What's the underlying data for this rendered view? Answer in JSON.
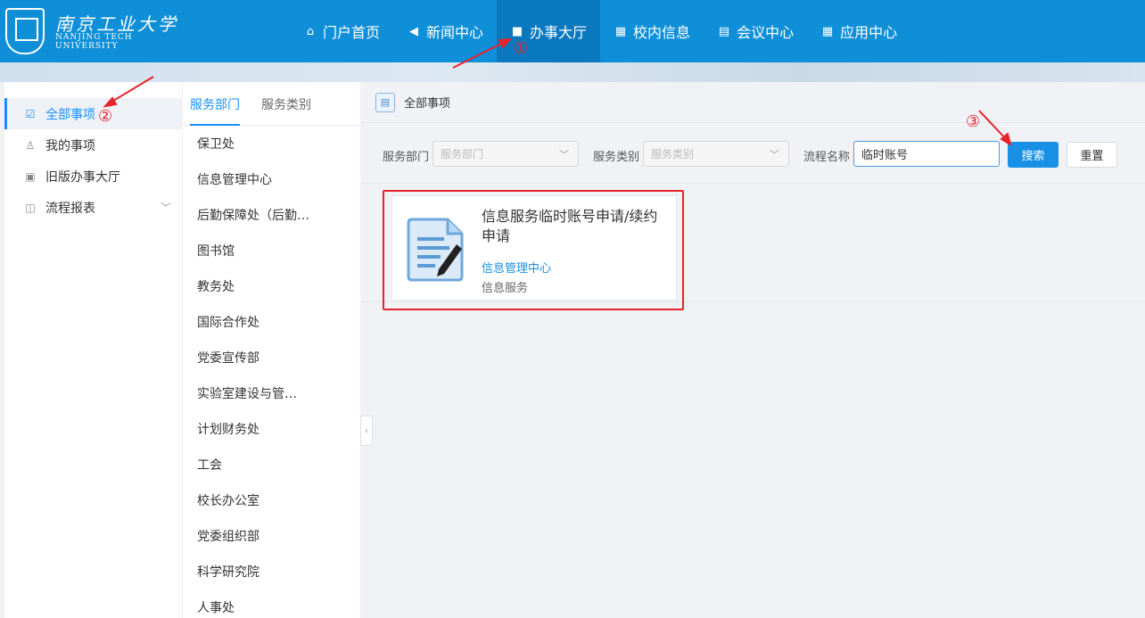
{
  "header": {
    "logo_cn": "南京工业大学",
    "logo_en_line1": "NANJING TECH",
    "logo_en_line2": "UNIVERSITY",
    "nav": [
      {
        "label": "门户首页",
        "icon": "home-icon",
        "glyph": "⌂"
      },
      {
        "label": "新闻中心",
        "icon": "speaker-icon",
        "glyph": "◀"
      },
      {
        "label": "办事大厅",
        "icon": "bag-icon",
        "glyph": "■"
      },
      {
        "label": "校内信息",
        "icon": "building-icon",
        "glyph": "▦"
      },
      {
        "label": "会议中心",
        "icon": "table-icon",
        "glyph": "▤"
      },
      {
        "label": "应用中心",
        "icon": "grid-icon",
        "glyph": "▦"
      }
    ]
  },
  "sidebar": {
    "items": [
      {
        "label": "全部事项",
        "icon": "checkbox-icon",
        "glyph": "☑"
      },
      {
        "label": "我的事项",
        "icon": "user-icon",
        "glyph": "♙"
      },
      {
        "label": "旧版办事大厅",
        "icon": "apps-icon",
        "glyph": "▣"
      },
      {
        "label": "流程报表",
        "icon": "chart-icon",
        "glyph": "◫"
      }
    ]
  },
  "departments": {
    "tabs": [
      "服务部门",
      "服务类别"
    ],
    "items": [
      "保卫处",
      "信息管理中心",
      "后勤保障处（后勤…",
      "图书馆",
      "教务处",
      "国际合作处",
      "党委宣传部",
      "实验室建设与管…",
      "计划财务处",
      "工会",
      "校长办公室",
      "党委组织部",
      "科学研究院",
      "人事处"
    ]
  },
  "main": {
    "title": "全部事项",
    "filters": {
      "dept_label": "服务部门",
      "dept_placeholder": "服务部门",
      "cat_label": "服务类别",
      "cat_placeholder": "服务类别",
      "name_label": "流程名称",
      "name_value": "临时账号",
      "search_button": "搜索",
      "reset_button": "重置"
    },
    "result": {
      "title": "信息服务临时账号申请/续约申请",
      "department": "信息管理中心",
      "category": "信息服务"
    }
  },
  "annotations": {
    "step1": "①",
    "step2": "②",
    "step3": "③"
  },
  "colors": {
    "header_bg": "#0e8fd8",
    "accent": "#1890e6",
    "annotation": "#e8222a"
  }
}
